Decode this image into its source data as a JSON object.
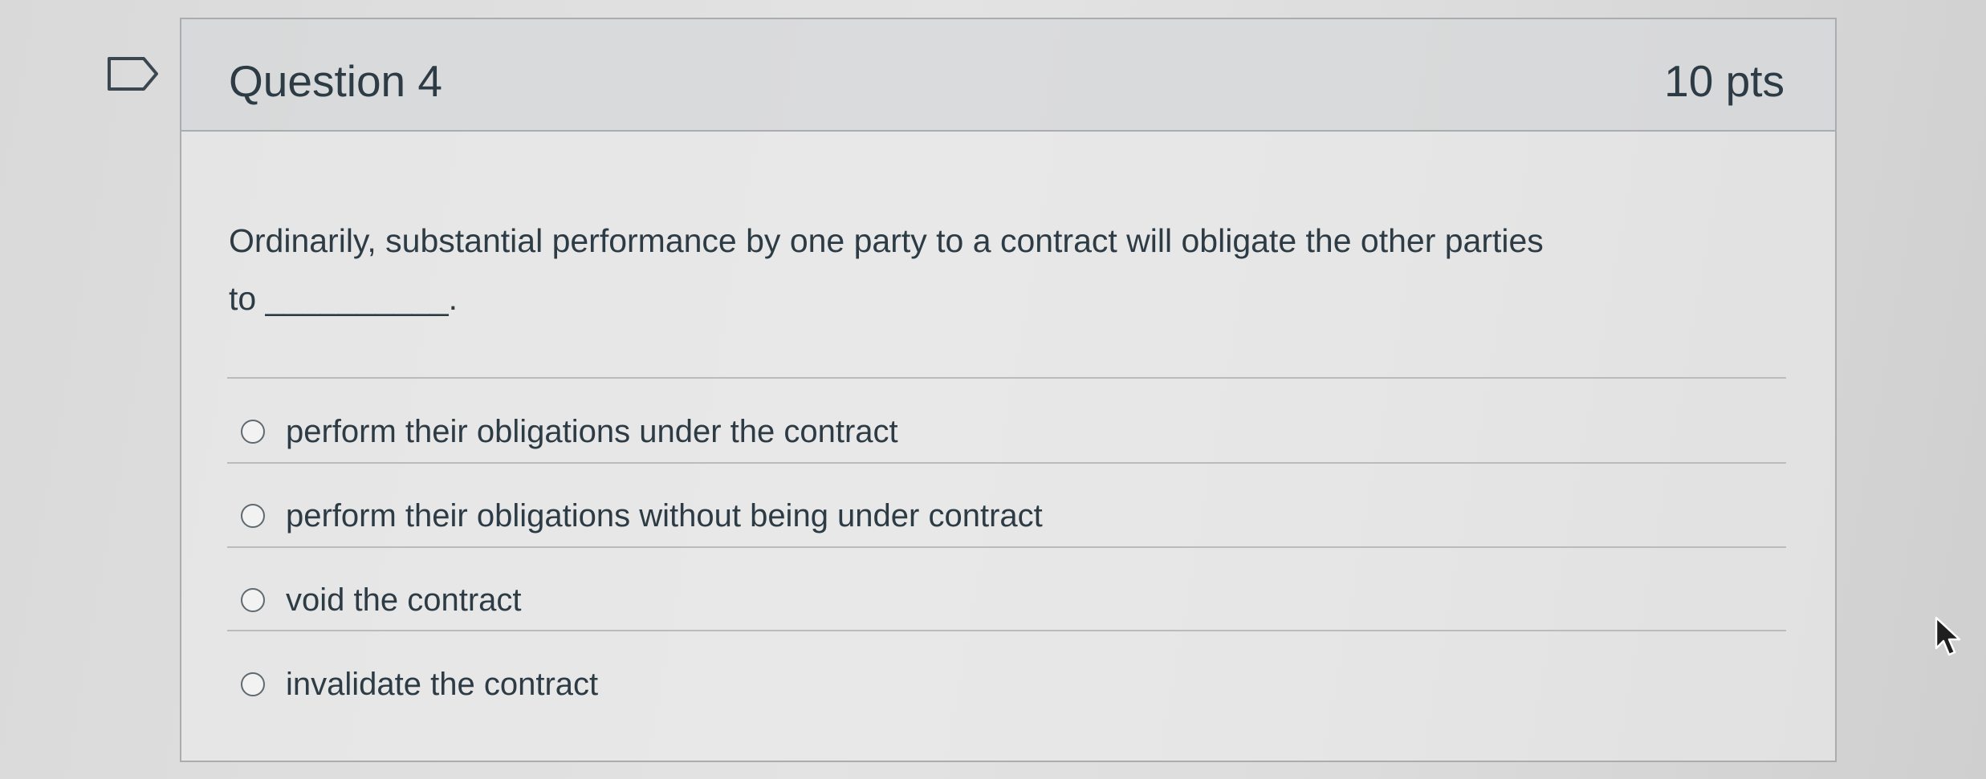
{
  "question": {
    "title": "Question 4",
    "points": "10 pts",
    "text_line1": "Ordinarily, substantial performance by one party to a contract will obligate the other parties",
    "text_line2": "to __________."
  },
  "answers": [
    {
      "label": "perform their obligations under the contract",
      "selected": false
    },
    {
      "label": "perform their obligations without being under contract",
      "selected": false
    },
    {
      "label": "void the contract",
      "selected": false
    },
    {
      "label": "invalidate the contract",
      "selected": false
    }
  ],
  "icons": {
    "flag": "flag-question-icon",
    "cursor": "mouse-pointer-icon"
  },
  "colors": {
    "text": "#2d3b45",
    "border": "#a9adb0"
  }
}
